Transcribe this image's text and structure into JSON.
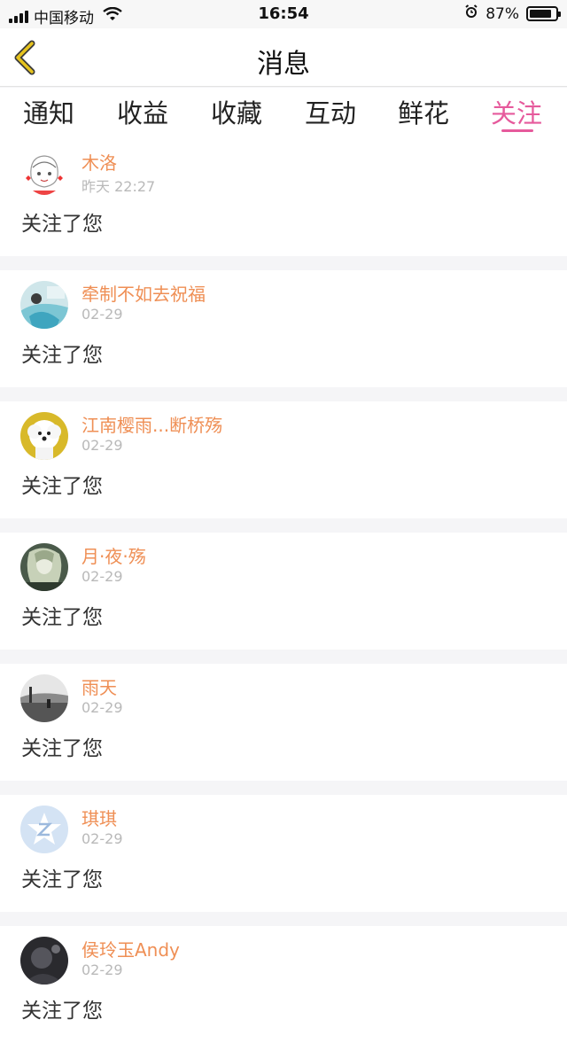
{
  "status_bar": {
    "carrier": "中国移动",
    "time": "16:54",
    "battery": "87%",
    "battery_level": 0.87
  },
  "nav": {
    "title": "消息",
    "back_icon": "chevron-left-icon",
    "accent_color": "#e6c31e"
  },
  "tabs": [
    {
      "label": "通知"
    },
    {
      "label": "收益"
    },
    {
      "label": "收藏"
    },
    {
      "label": "互动"
    },
    {
      "label": "鲜花"
    },
    {
      "label": "关注",
      "active": true
    }
  ],
  "colors": {
    "active_tab": "#e65a9c",
    "username": "#ef8f55",
    "timestamp": "#b9b9b9"
  },
  "feed": [
    {
      "name": "木洛",
      "time": "昨天 22:27",
      "text": "关注了您",
      "avatar": "cartoon-girl-avatar"
    },
    {
      "name": "牵制不如去祝福",
      "time": "02-29",
      "text": "关注了您",
      "avatar": "blue-dress-photo-avatar"
    },
    {
      "name": "江南樱雨...断桥殇",
      "time": "02-29",
      "text": "关注了您",
      "avatar": "white-dog-avatar"
    },
    {
      "name": "月·夜·殇",
      "time": "02-29",
      "text": "关注了您",
      "avatar": "anime-figure-avatar"
    },
    {
      "name": "雨天",
      "time": "02-29",
      "text": "关注了您",
      "avatar": "grayscale-landscape-avatar"
    },
    {
      "name": "琪琪",
      "time": "02-29",
      "text": "关注了您",
      "avatar": "default-z-avatar"
    },
    {
      "name": "侯玲玉Andy",
      "time": "02-29",
      "text": "关注了您",
      "avatar": "dark-photo-avatar"
    }
  ]
}
